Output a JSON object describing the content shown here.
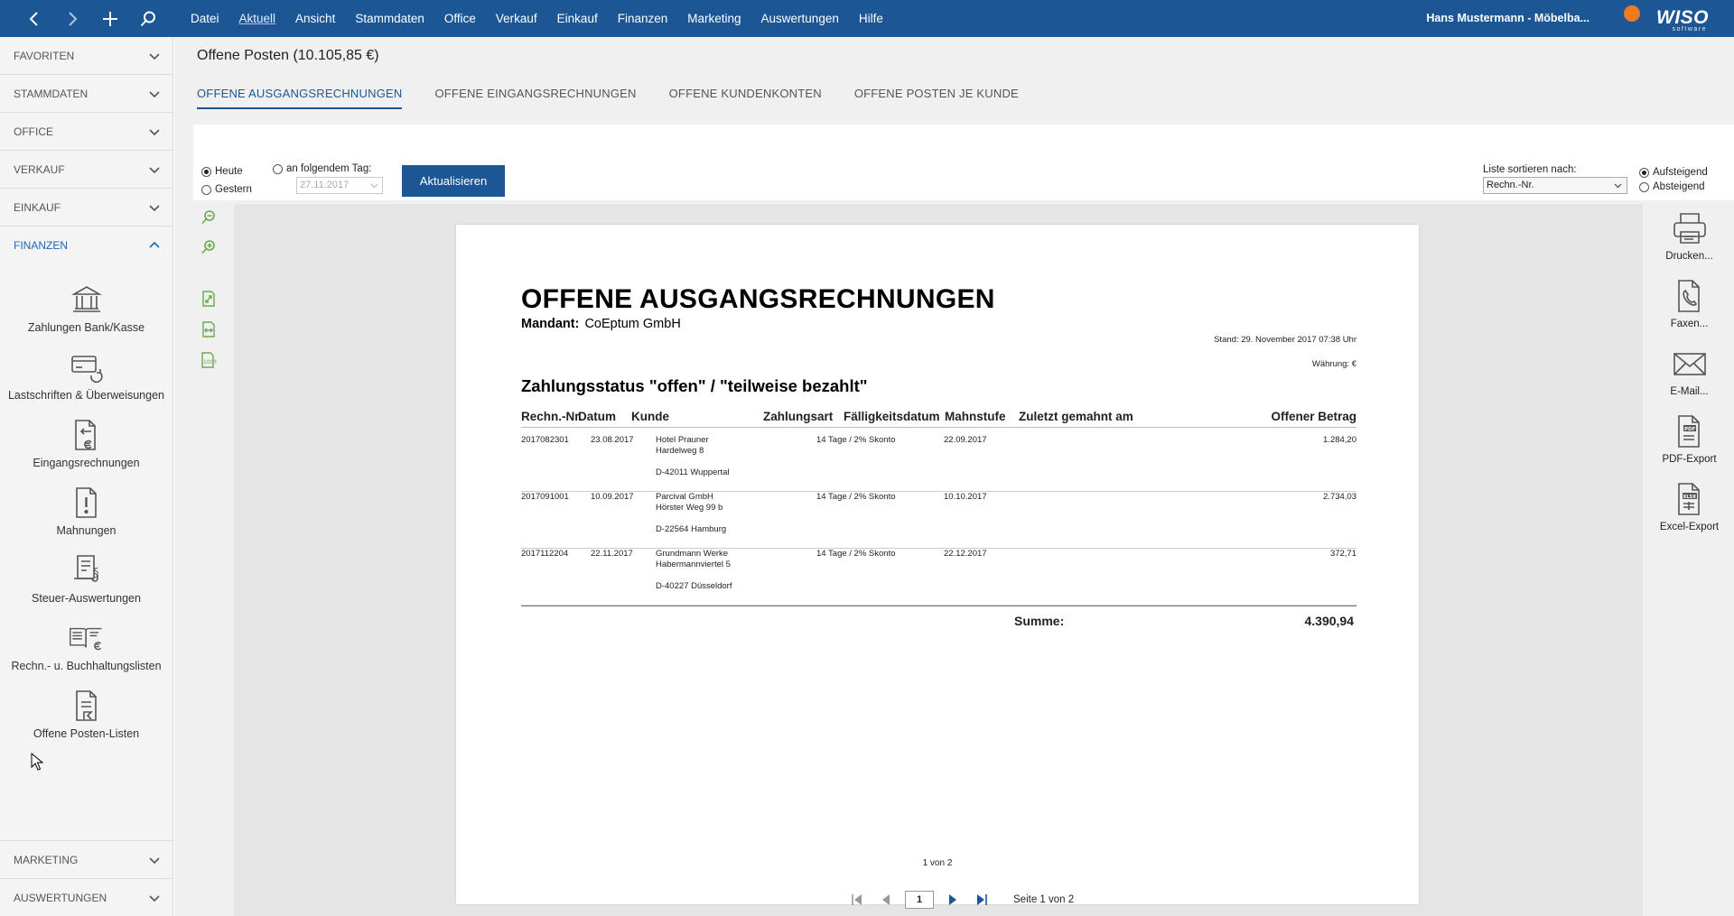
{
  "menu": [
    "Datei",
    "Aktuell",
    "Ansicht",
    "Stammdaten",
    "Office",
    "Verkauf",
    "Einkauf",
    "Finanzen",
    "Marketing",
    "Auswertungen",
    "Hilfe"
  ],
  "user": "Hans Mustermann - Möbelba...",
  "logo": {
    "name": "WISO",
    "sub": "software"
  },
  "sidebar": {
    "sections_top": [
      "FAVORITEN",
      "STAMMDATEN",
      "OFFICE",
      "VERKAUF",
      "EINKAUF"
    ],
    "open_section": "FINANZEN",
    "items": [
      "Zahlungen Bank/Kasse",
      "Lastschriften & Überweisungen",
      "Eingangsrechnungen",
      "Mahnungen",
      "Steuer-Auswertungen",
      "Rechn.- u. Buchhaltungslisten",
      "Offene Posten-Listen"
    ],
    "sections_bottom": [
      "MARKETING",
      "AUSWERTUNGEN"
    ]
  },
  "page_title": "Offene Posten (10.105,85 €)",
  "tabs": [
    "OFFENE AUSGANGSRECHNUNGEN",
    "OFFENE EINGANGSRECHNUNGEN",
    "OFFENE KUNDENKONTEN",
    "OFFENE POSTEN JE KUNDE"
  ],
  "filter": {
    "heute": "Heute",
    "gestern": "Gestern",
    "tag": "an folgendem Tag:",
    "date": "27.11.2017",
    "button": "Aktualisieren",
    "sort_label": "Liste sortieren nach:",
    "sort_value": "Rechn.-Nr.",
    "auf": "Aufsteigend",
    "ab": "Absteigend"
  },
  "report": {
    "title": "OFFENE AUSGANGSRECHNUNGEN",
    "mandant_label": "Mandant:",
    "mandant": "CoEptum GmbH",
    "stand": "Stand:  29. November 2017 07:38 Uhr",
    "waehrung": "Währung: €",
    "subtitle": "Zahlungsstatus \"offen\" / \"teilweise bezahlt\"",
    "headers": [
      "Rechn.-Nr.",
      "Datum",
      "Kunde",
      "Zahlungsart",
      "Fälligkeitsdatum",
      "Mahnstufe",
      "Zuletzt gemahnt am",
      "Offener Betrag"
    ],
    "rows": [
      {
        "nr": "2017082301",
        "datum": "23.08.2017",
        "kunde1": "Hotel Prauner",
        "kunde2": "Hardelweg 8",
        "kunde3": "D-42011 Wuppertal",
        "zahlungsart": "14 Tage / 2% Skonto",
        "faellig": "22.09.2017",
        "betrag": "1.284,20"
      },
      {
        "nr": "2017091001",
        "datum": "10.09.2017",
        "kunde1": "Parcival GmbH",
        "kunde2": "Hörster Weg 99 b",
        "kunde3": "D-22564 Hamburg",
        "zahlungsart": "14 Tage / 2% Skonto",
        "faellig": "10.10.2017",
        "betrag": "2.734,03"
      },
      {
        "nr": "2017112204",
        "datum": "22.11.2017",
        "kunde1": "Grundmann Werke",
        "kunde2": "Habermannviertel 5",
        "kunde3": "D-40227 Düsseldorf",
        "zahlungsart": "14 Tage / 2% Skonto",
        "faellig": "22.12.2017",
        "betrag": "372,71"
      }
    ],
    "sum_label": "Summe:",
    "sum_value": "4.390,94",
    "page_footer": "1 von 2"
  },
  "actions": [
    "Drucken...",
    "Faxen...",
    "E-Mail...",
    "PDF-Export",
    "Excel-Export"
  ],
  "pager": {
    "current": "1",
    "label": "Seite 1 von 2"
  },
  "colors": {
    "brand": "#1c5694",
    "accent_green": "#6aa84f"
  }
}
